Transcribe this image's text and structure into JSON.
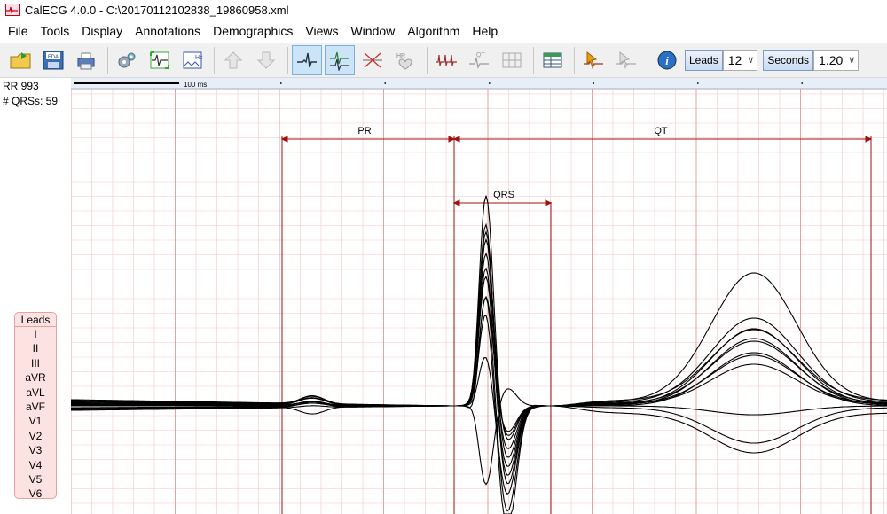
{
  "window": {
    "title": "CalECG 4.0.0 - C:\\20170112102838_19860958.xml"
  },
  "menu": [
    "File",
    "Tools",
    "Display",
    "Annotations",
    "Demographics",
    "Views",
    "Window",
    "Algorithm",
    "Help"
  ],
  "toolbar": {
    "leads_label": "Leads",
    "leads_value": "12",
    "seconds_label": "Seconds",
    "seconds_value": "1.20"
  },
  "info": {
    "rr": "RR 993",
    "qrs_count": "# QRSs: 59"
  },
  "scale_bar": {
    "label": "100 ms"
  },
  "intervals": {
    "pr": "PR",
    "qt": "QT",
    "qrs": "QRS"
  },
  "leads": {
    "title": "Leads",
    "items": [
      "I",
      "II",
      "III",
      "aVR",
      "aVL",
      "aVF",
      "V1",
      "V2",
      "V3",
      "V4",
      "V5",
      "V6"
    ]
  },
  "colors": {
    "grid": "#f5c5c5",
    "interval": "#a01010",
    "trace": "#000000",
    "legend_bg": "#fde2e2"
  }
}
